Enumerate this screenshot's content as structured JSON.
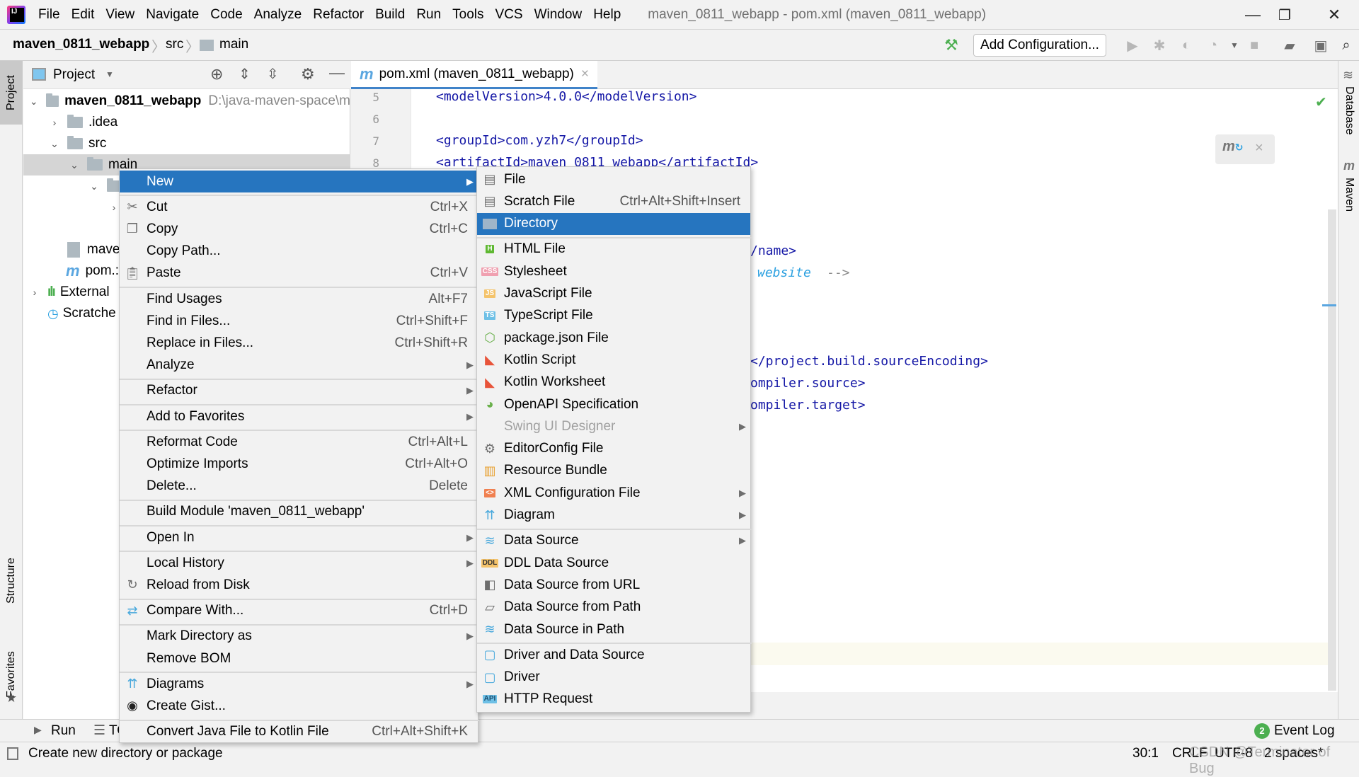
{
  "window": {
    "title": "maven_0811_webapp - pom.xml (maven_0811_webapp)",
    "minimize": "—",
    "restore": "❐",
    "close": "✕"
  },
  "menubar": [
    "File",
    "Edit",
    "View",
    "Navigate",
    "Code",
    "Analyze",
    "Refactor",
    "Build",
    "Run",
    "Tools",
    "VCS",
    "Window",
    "Help"
  ],
  "breadcrumb": {
    "project": "maven_0811_webapp",
    "sep": "〉",
    "src": "src",
    "main": "main"
  },
  "toolbar": {
    "add_configuration": "Add Configuration..."
  },
  "left_stripe": {
    "project": "Project",
    "structure": "Structure",
    "favorites": "Favorites"
  },
  "right_stripe": {
    "database": "Database",
    "maven": "Maven"
  },
  "project_panel": {
    "title": "Project",
    "tree": [
      {
        "label": "maven_0811_webapp",
        "path": "D:\\java-maven-space\\m"
      },
      {
        "label": ".idea"
      },
      {
        "label": "src"
      },
      {
        "label": "main"
      },
      {
        "label": ""
      },
      {
        "label": ""
      },
      {
        "label": "mave"
      },
      {
        "label": "pom.:"
      },
      {
        "label": "External"
      },
      {
        "label": "Scratche"
      }
    ]
  },
  "editor": {
    "tab_label": "pom.xml (maven_0811_webapp)",
    "lines": [
      {
        "num": "5",
        "text": "<modelVersion>4.0.0</modelVersion>"
      },
      {
        "num": "6",
        "text": ""
      },
      {
        "num": "7",
        "text": "<groupId>com.yzh7</groupId>"
      },
      {
        "num": "8",
        "text": "<artifactId>maven_0811_webapp</artifactId>"
      }
    ],
    "visible_fragments": {
      "name_close": "/name>",
      "comment_word": "website",
      "comment_end": "-->",
      "encoding": "</project.build.sourceEncoding>",
      "compiler_source": "ompiler.source>",
      "compiler_target": "ompiler.target>"
    }
  },
  "context_menu": {
    "items": [
      {
        "label": "New",
        "icon": "",
        "shortcut": "",
        "submenu": true,
        "highlighted": true
      },
      {
        "sep": true
      },
      {
        "label": "Cut",
        "icon": "scissors-icon",
        "shortcut": "Ctrl+X"
      },
      {
        "label": "Copy",
        "icon": "copy-icon",
        "shortcut": "Ctrl+C"
      },
      {
        "label": "Copy Path...",
        "icon": "",
        "shortcut": ""
      },
      {
        "label": "Paste",
        "icon": "paste-icon",
        "shortcut": "Ctrl+V"
      },
      {
        "sep": true
      },
      {
        "label": "Find Usages",
        "shortcut": "Alt+F7"
      },
      {
        "label": "Find in Files...",
        "shortcut": "Ctrl+Shift+F"
      },
      {
        "label": "Replace in Files...",
        "shortcut": "Ctrl+Shift+R"
      },
      {
        "label": "Analyze",
        "submenu": true
      },
      {
        "sep": true
      },
      {
        "label": "Refactor",
        "submenu": true
      },
      {
        "sep": true
      },
      {
        "label": "Add to Favorites",
        "submenu": true
      },
      {
        "sep": true
      },
      {
        "label": "Reformat Code",
        "shortcut": "Ctrl+Alt+L"
      },
      {
        "label": "Optimize Imports",
        "shortcut": "Ctrl+Alt+O"
      },
      {
        "label": "Delete...",
        "shortcut": "Delete"
      },
      {
        "sep": true
      },
      {
        "label": "Build Module 'maven_0811_webapp'"
      },
      {
        "sep": true
      },
      {
        "label": "Open In",
        "submenu": true
      },
      {
        "sep": true
      },
      {
        "label": "Local History",
        "submenu": true
      },
      {
        "label": "Reload from Disk",
        "icon": "reload-icon"
      },
      {
        "sep": true
      },
      {
        "label": "Compare With...",
        "icon": "compare-icon",
        "shortcut": "Ctrl+D"
      },
      {
        "sep": true
      },
      {
        "label": "Mark Directory as",
        "submenu": true
      },
      {
        "label": "Remove BOM"
      },
      {
        "sep": true
      },
      {
        "label": "Diagrams",
        "icon": "diagram-icon",
        "submenu": true
      },
      {
        "label": "Create Gist...",
        "icon": "github-icon"
      },
      {
        "sep": true
      },
      {
        "label": "Convert Java File to Kotlin File",
        "shortcut": "Ctrl+Alt+Shift+K"
      }
    ]
  },
  "new_submenu": {
    "items": [
      {
        "label": "File",
        "icon": "file-icon"
      },
      {
        "label": "Scratch File",
        "icon": "scratch-file-icon",
        "shortcut": "Ctrl+Alt+Shift+Insert"
      },
      {
        "label": "Directory",
        "icon": "folder-icon",
        "highlighted": true
      },
      {
        "sep": true
      },
      {
        "label": "HTML File",
        "icon": "html-file-icon",
        "badge": "H",
        "badge_color": "#5fb832"
      },
      {
        "label": "Stylesheet",
        "icon": "css-file-icon",
        "badge": "CSS",
        "badge_color": "#f0a0b0"
      },
      {
        "label": "JavaScript File",
        "icon": "js-file-icon",
        "badge": "JS",
        "badge_color": "#f4c36b"
      },
      {
        "label": "TypeScript File",
        "icon": "ts-file-icon",
        "badge": "TS",
        "badge_color": "#6ec0e6"
      },
      {
        "label": "package.json File",
        "icon": "nodejs-icon"
      },
      {
        "label": "Kotlin Script",
        "icon": "kotlin-icon"
      },
      {
        "label": "Kotlin Worksheet",
        "icon": "kotlin-icon"
      },
      {
        "label": "OpenAPI Specification",
        "icon": "openapi-icon"
      },
      {
        "label": "Swing UI Designer",
        "disabled": true,
        "submenu": true
      },
      {
        "label": "EditorConfig File",
        "icon": "gear-icon"
      },
      {
        "label": "Resource Bundle",
        "icon": "resource-bundle-icon"
      },
      {
        "label": "XML Configuration File",
        "icon": "xml-file-icon",
        "submenu": true
      },
      {
        "label": "Diagram",
        "icon": "diagram-icon",
        "submenu": true
      },
      {
        "sep": true
      },
      {
        "label": "Data Source",
        "icon": "database-icon",
        "submenu": true
      },
      {
        "label": "DDL Data Source",
        "icon": "ddl-icon"
      },
      {
        "label": "Data Source from URL",
        "icon": "url-plug-icon"
      },
      {
        "label": "Data Source from Path",
        "icon": "folder-open-icon"
      },
      {
        "label": "Data Source in Path",
        "icon": "database-icon"
      },
      {
        "sep": true
      },
      {
        "label": "Driver and Data Source",
        "icon": "driver-icon"
      },
      {
        "label": "Driver",
        "icon": "driver-icon"
      },
      {
        "label": "HTTP Request",
        "icon": "api-icon"
      }
    ]
  },
  "bottom_bar": {
    "run": "Run",
    "todo": "TO",
    "event_log": "Event Log",
    "event_count": "2"
  },
  "status_bar": {
    "message": "Create new directory or package",
    "position": "30:1",
    "line_sep": "CRLF",
    "encoding": "UTF-8",
    "indent": "2 spaces*",
    "watermark": "CSDN @Terminator of Bug"
  },
  "colors": {
    "highlight": "#2675bf",
    "accent": "#4083c9",
    "tag": "#1417a6"
  }
}
